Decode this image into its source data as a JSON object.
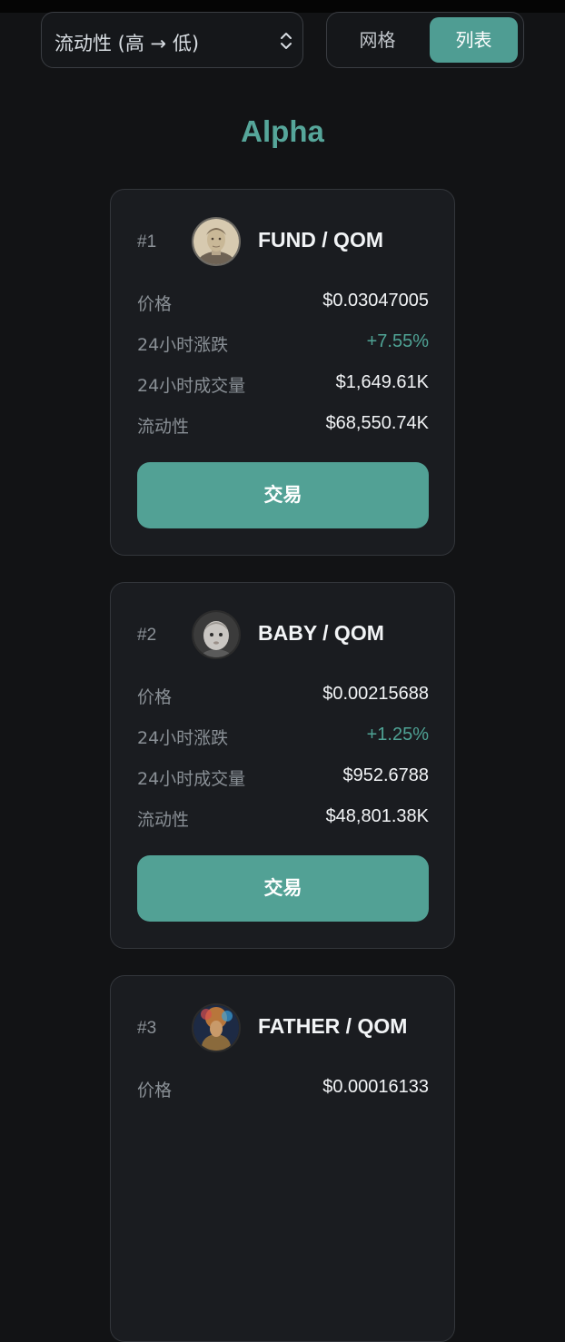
{
  "toolbar": {
    "sort_label": "流动性 (高 → 低)",
    "view_grid_label": "网格",
    "view_list_label": "列表"
  },
  "section": {
    "title": "Alpha"
  },
  "colors": {
    "accent": "#52a195",
    "positive": "#4fa395",
    "background": "#121315",
    "card": "#1a1c20"
  },
  "labels": {
    "price": "价格",
    "change_24h": "24小时涨跌",
    "volume_24h": "24小时成交量",
    "liquidity": "流动性",
    "trade": "交易"
  },
  "tokens": [
    {
      "rank": "#1",
      "pair": "FUND / QOM",
      "avatar_icon": "vintage-portrait-avatar",
      "price": "$0.03047005",
      "change_24h": "+7.55%",
      "volume_24h": "$1,649.61K",
      "liquidity": "$68,550.74K"
    },
    {
      "rank": "#2",
      "pair": "BABY / QOM",
      "avatar_icon": "baby-portrait-avatar",
      "price": "$0.00215688",
      "change_24h": "+1.25%",
      "volume_24h": "$952.6788",
      "liquidity": "$48,801.38K"
    },
    {
      "rank": "#3",
      "pair": "FATHER / QOM",
      "avatar_icon": "painted-figure-avatar",
      "price": "$0.00016133"
    }
  ]
}
